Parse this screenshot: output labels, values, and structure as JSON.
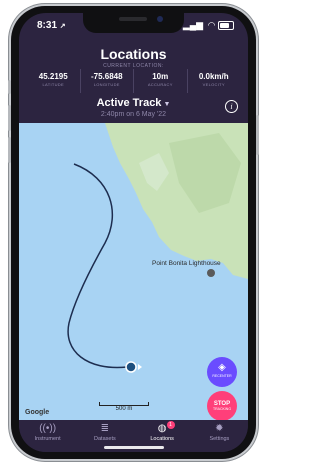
{
  "status": {
    "time": "8:31",
    "location_arrow": "↗"
  },
  "header": {
    "title": "Locations",
    "current_location_label": "CURRENT LOCATION:",
    "stats": [
      {
        "value": "45.2195",
        "label": "LATITUDE"
      },
      {
        "value": "-75.6848",
        "label": "LONGITUDE"
      },
      {
        "value": "10m",
        "label": "ACCURACY"
      },
      {
        "value": "0.0km/h",
        "label": "VELOCITY"
      }
    ],
    "track_name": "Active Track",
    "track_date": "2:40pm on 6 May '22"
  },
  "map": {
    "landmark_label": "Point Bonita Lighthouse",
    "attribution": "Google",
    "scale_label": "500 m",
    "colors": {
      "water": "#a8d3f3",
      "land": "#c9e2b8",
      "track": "#1d2d4f"
    }
  },
  "actions": {
    "recenter_label": "RECENTER",
    "stop_label": "STOP",
    "stop_sub": "TRACKING"
  },
  "tabs": [
    {
      "label": "Instrument",
      "icon": "antenna-icon"
    },
    {
      "label": "Datasets",
      "icon": "database-icon"
    },
    {
      "label": "Locations",
      "icon": "globe-icon",
      "badge": "1"
    },
    {
      "label": "Settings",
      "icon": "gear-icon"
    }
  ],
  "theme": {
    "primary": "#2c2440",
    "accent_recenter": "#6a4cff",
    "accent_stop": "#ff3f7a"
  }
}
